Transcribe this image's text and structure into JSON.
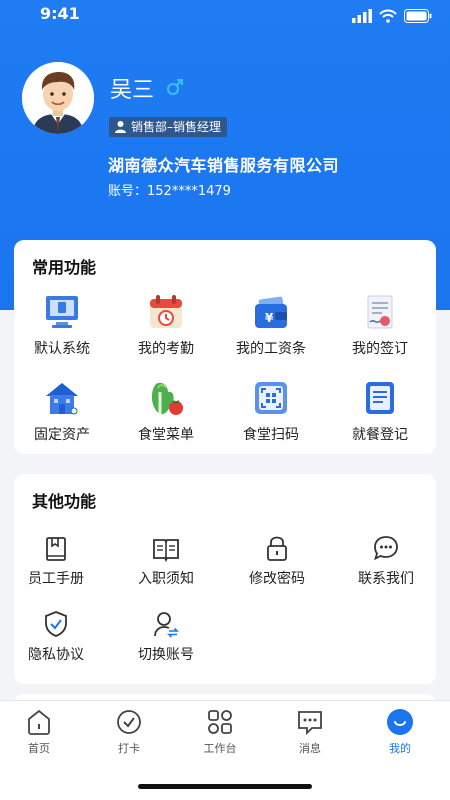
{
  "status": {
    "time": "9:41"
  },
  "profile": {
    "name": "吴三",
    "department": "销售部–销售经理",
    "company": "湖南德众汽车销售服务有限公司",
    "account": "账号：152****1479"
  },
  "common": {
    "title": "常用功能",
    "items": [
      {
        "label": "默认系统",
        "icon": "monitor-icon"
      },
      {
        "label": "我的考勤",
        "icon": "calendar-icon"
      },
      {
        "label": "我的工资条",
        "icon": "wallet-icon"
      },
      {
        "label": "我的签订",
        "icon": "contract-icon"
      },
      {
        "label": "固定资产",
        "icon": "building-icon"
      },
      {
        "label": "食堂菜单",
        "icon": "vegetable-icon"
      },
      {
        "label": "食堂扫码",
        "icon": "scan-icon"
      },
      {
        "label": "就餐登记",
        "icon": "register-icon"
      }
    ]
  },
  "other": {
    "title": "其他功能",
    "items": [
      {
        "label": "员工手册",
        "icon": "handbook-icon"
      },
      {
        "label": "入职须知",
        "icon": "open-book-icon"
      },
      {
        "label": "修改密码",
        "icon": "lock-icon"
      },
      {
        "label": "联系我们",
        "icon": "chat-icon"
      },
      {
        "label": "隐私协议",
        "icon": "shield-icon"
      },
      {
        "label": "切换账号",
        "icon": "switch-user-icon"
      }
    ]
  },
  "tabs": [
    {
      "label": "首页",
      "icon": "home-icon"
    },
    {
      "label": "打卡",
      "icon": "check-in-icon"
    },
    {
      "label": "工作台",
      "icon": "workbench-icon"
    },
    {
      "label": "消息",
      "icon": "message-icon"
    },
    {
      "label": "我的",
      "icon": "profile-icon",
      "active": true
    }
  ],
  "colors": {
    "primary": "#1a75ef",
    "gender": "#35c2f6"
  }
}
